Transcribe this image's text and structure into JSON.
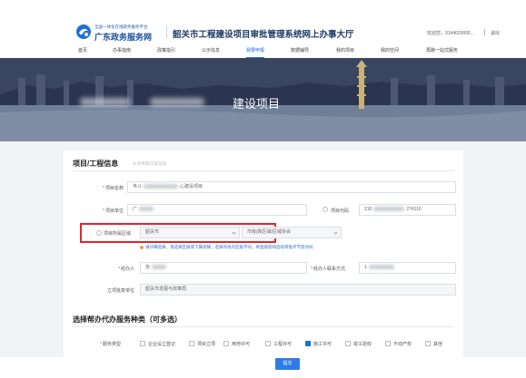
{
  "header": {
    "brand_sub": "全国一体化在线政务服务平台",
    "brand_main": "广东政务服务网",
    "system_title": "韶关市工程建设项目审批管理系统网上办事大厅",
    "welcome": "欢迎您，9144020006...",
    "logout": "退出"
  },
  "nav": {
    "items": [
      {
        "label": "首页"
      },
      {
        "label": "办事指南"
      },
      {
        "label": "政策指引"
      },
      {
        "label": "公示信息"
      },
      {
        "label": "我要申报"
      },
      {
        "label": "数据辅导"
      },
      {
        "label": "我的项目"
      },
      {
        "label": "我的空间"
      },
      {
        "label": "再跑一站式服务"
      }
    ],
    "active_index": 4
  },
  "banner": {
    "title_suffix": "建设项目"
  },
  "section1": {
    "title": "项目/工程信息",
    "hint": "补充项目/工程信息"
  },
  "form": {
    "project_name_label": "项目名称",
    "project_name_prefix": "韦斗",
    "project_name_suffix": "心建设项目",
    "project_unit_label": "项目单位",
    "project_unit_prefix": "广",
    "project_code_label": "项目代码",
    "project_code_prefix": "210",
    "project_code_suffix": "274116",
    "district_label": "项目所属区域",
    "district_city": "韶关市",
    "district_county": "市级(跨区域/区域协会",
    "district_hint": "请仔细选择，须选择区级或下属街镇，选择的地点区级不同，将直接影响后续审批环节及时间",
    "agent_label": "经办人",
    "agent_prefix": "张",
    "agent_contact_label": "经办人联系方式",
    "agent_contact_prefix": "1",
    "approval_dept_label": "立项批复单位",
    "approval_dept_value": "韶关市发展与改革局"
  },
  "section2": {
    "title": "选择帮办代办服务种类（可多选）"
  },
  "services": {
    "label": "服务类型",
    "options": [
      {
        "label": "企业设立登记",
        "checked": false
      },
      {
        "label": "项目立项",
        "checked": false
      },
      {
        "label": "用地许可",
        "checked": false
      },
      {
        "label": "工程许可",
        "checked": false
      },
      {
        "label": "施工许可",
        "checked": true
      },
      {
        "label": "竣工验收",
        "checked": false
      },
      {
        "label": "不动产权",
        "checked": false
      },
      {
        "label": "其他",
        "checked": false
      }
    ]
  },
  "submit_label": "提交",
  "colors": {
    "primary": "#1f6fd6",
    "highlight_border": "#e0262b",
    "required": "#e23b3b"
  }
}
